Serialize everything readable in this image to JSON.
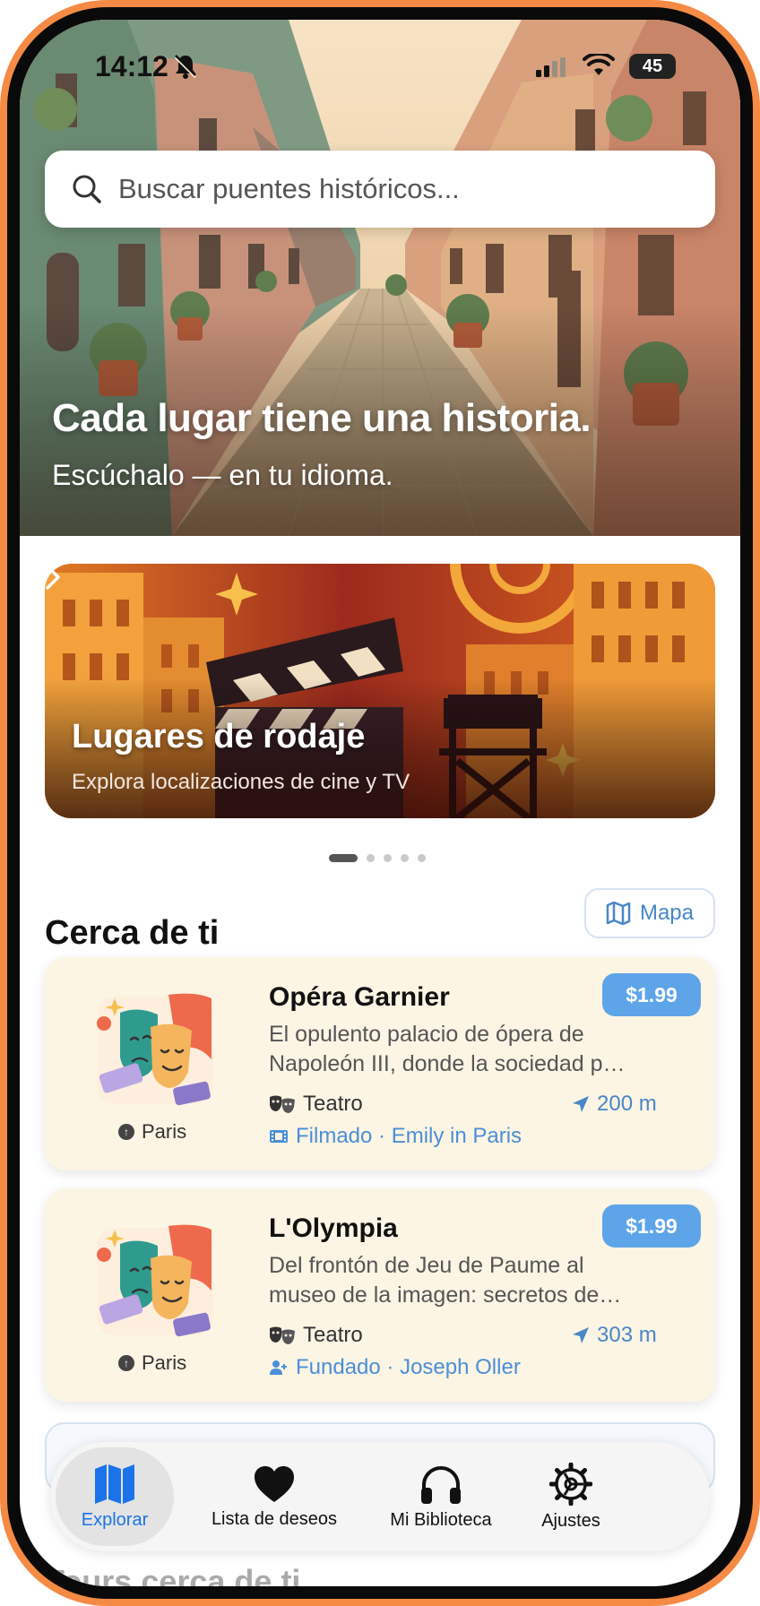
{
  "status_bar": {
    "time": "14:12",
    "battery": "45"
  },
  "hero": {
    "title": "Cada lugar tiene una historia.",
    "subtitle": "Escúchalo — en tu idioma."
  },
  "search": {
    "placeholder": "Buscar puentes históricos..."
  },
  "promo": {
    "title": "Lugares de rodaje",
    "subtitle": "Explora localizaciones de cine y TV",
    "page_index": 1,
    "page_count": 5
  },
  "nearby": {
    "title": "Cerca de ti",
    "map_button": "Mapa",
    "places": [
      {
        "name": "Opéra Garnier",
        "description_line1": "El opulento palacio de ópera de",
        "description_line2": "Napoleón III, donde la sociedad p…",
        "category": "Teatro",
        "distance": "200 m",
        "city": "Paris",
        "price": "$1.99",
        "tag": "Filmado · Emily in Paris",
        "tag_icon": "film-icon"
      },
      {
        "name": "L'Olympia",
        "description_line1": "Del frontón de Jeu de Paume al",
        "description_line2": "museo de la imagen: secretos de…",
        "category": "Teatro",
        "distance": "303 m",
        "city": "Paris",
        "price": "$1.99",
        "tag": "Fundado · Joseph Oller",
        "tag_icon": "person-icon"
      }
    ]
  },
  "below_fold": {
    "section_title": "Tours cerca de ti"
  },
  "tab_bar": {
    "tabs": [
      {
        "label": "Explorar",
        "icon": "map-icon",
        "active": true
      },
      {
        "label": "Lista de deseos",
        "icon": "heart-icon",
        "active": false
      },
      {
        "label": "Mi Biblioteca",
        "icon": "headphones-icon",
        "active": false
      },
      {
        "label": "Ajustes",
        "icon": "gear-icon",
        "active": false
      }
    ]
  },
  "colors": {
    "frame": "#f58a45",
    "accent": "#1a73e8",
    "price_badge": "#5ea4e8",
    "card_background": "#fdf5e3"
  }
}
